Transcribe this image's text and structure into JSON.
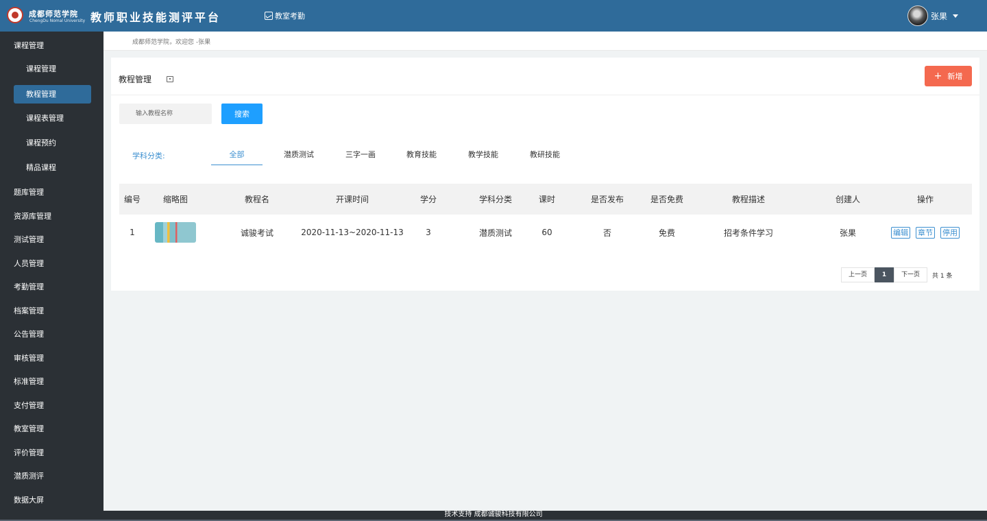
{
  "header": {
    "logo_cn": "成都师范学院",
    "logo_en": "ChengDu Nomal University",
    "platform_title": "教师职业技能测评平台",
    "nav_link": "教室考勤",
    "user_name": "张果"
  },
  "sidebar": {
    "items": [
      {
        "label": "课程管理"
      },
      {
        "label": "课程管理"
      },
      {
        "label": "教程管理"
      },
      {
        "label": "课程表管理"
      },
      {
        "label": "课程预约"
      },
      {
        "label": "精品课程"
      },
      {
        "label": "题库管理"
      },
      {
        "label": "资源库管理"
      },
      {
        "label": "测试管理"
      },
      {
        "label": "人员管理"
      },
      {
        "label": "考勤管理"
      },
      {
        "label": "档案管理"
      },
      {
        "label": "公告管理"
      },
      {
        "label": "审核管理"
      },
      {
        "label": "标准管理"
      },
      {
        "label": "支付管理"
      },
      {
        "label": "教室管理"
      },
      {
        "label": "评价管理"
      },
      {
        "label": "潜质测评"
      },
      {
        "label": "数据大屏"
      }
    ]
  },
  "breadcrumb": "成都师范学院，欢迎您 -张果",
  "panel": {
    "title": "教程管理",
    "add_label": "新增",
    "search_placeholder": "输入教程名称",
    "search_label": "搜索"
  },
  "filters": {
    "label": "学科分类:",
    "tabs": [
      "全部",
      "潜质测试",
      "三字一画",
      "教育技能",
      "教学技能",
      "教研技能"
    ]
  },
  "table": {
    "headers": [
      "编号",
      "缩略图",
      "教程名",
      "开课时间",
      "学分",
      "学科分类",
      "课时",
      "是否发布",
      "是否免费",
      "教程描述",
      "创建人",
      "操作"
    ],
    "rows": [
      {
        "id": "1",
        "name": "诚骏考试",
        "time": "2020-11-13~2020-11-13",
        "credit": "3",
        "category": "潜质测试",
        "hours": "60",
        "published": "否",
        "free": "免费",
        "desc": "招考条件学习",
        "creator": "张果",
        "ops": [
          "编辑",
          "章节",
          "停用"
        ]
      }
    ]
  },
  "pagination": {
    "prev": "上一页",
    "current": "1",
    "next": "下一页",
    "total": "共 1 条"
  },
  "footer": "技术支持 成都诚骏科技有限公司"
}
